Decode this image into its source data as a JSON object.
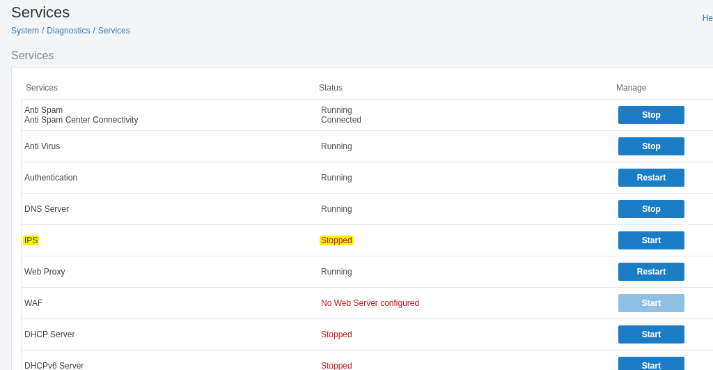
{
  "page": {
    "title": "Services",
    "help_link": "He"
  },
  "breadcrumb": {
    "items": [
      "System",
      "Diagnostics",
      "Services"
    ],
    "separator": "/"
  },
  "section": {
    "title": "Services"
  },
  "table": {
    "columns": [
      "Services",
      "Status",
      "Manage"
    ],
    "rows": [
      {
        "service": [
          "Anti Spam",
          "Anti Spam Center Connectivity"
        ],
        "status": [
          {
            "text": "Running",
            "kind": "ok"
          },
          {
            "text": "Connected",
            "kind": "ok"
          }
        ],
        "action": {
          "label": "Stop",
          "disabled": false
        },
        "highlighted": false
      },
      {
        "service": [
          "Anti Virus"
        ],
        "status": [
          {
            "text": "Running",
            "kind": "ok"
          }
        ],
        "action": {
          "label": "Stop",
          "disabled": false
        },
        "highlighted": false
      },
      {
        "service": [
          "Authentication"
        ],
        "status": [
          {
            "text": "Running",
            "kind": "ok"
          }
        ],
        "action": {
          "label": "Restart",
          "disabled": false
        },
        "highlighted": false
      },
      {
        "service": [
          "DNS Server"
        ],
        "status": [
          {
            "text": "Running",
            "kind": "ok"
          }
        ],
        "action": {
          "label": "Stop",
          "disabled": false
        },
        "highlighted": false
      },
      {
        "service": [
          "IPS"
        ],
        "status": [
          {
            "text": "Stopped",
            "kind": "error"
          }
        ],
        "action": {
          "label": "Start",
          "disabled": false
        },
        "highlighted": true
      },
      {
        "service": [
          "Web Proxy"
        ],
        "status": [
          {
            "text": "Running",
            "kind": "ok"
          }
        ],
        "action": {
          "label": "Restart",
          "disabled": false
        },
        "highlighted": false
      },
      {
        "service": [
          "WAF"
        ],
        "status": [
          {
            "text": "No Web Server configured",
            "kind": "error"
          }
        ],
        "action": {
          "label": "Start",
          "disabled": true
        },
        "highlighted": false
      },
      {
        "service": [
          "DHCP Server"
        ],
        "status": [
          {
            "text": "Stopped",
            "kind": "error"
          }
        ],
        "action": {
          "label": "Start",
          "disabled": false
        },
        "highlighted": false
      },
      {
        "service": [
          "DHCPv6 Server"
        ],
        "status": [
          {
            "text": "Stopped",
            "kind": "error"
          }
        ],
        "action": {
          "label": "Start",
          "disabled": false
        },
        "highlighted": false
      }
    ]
  }
}
